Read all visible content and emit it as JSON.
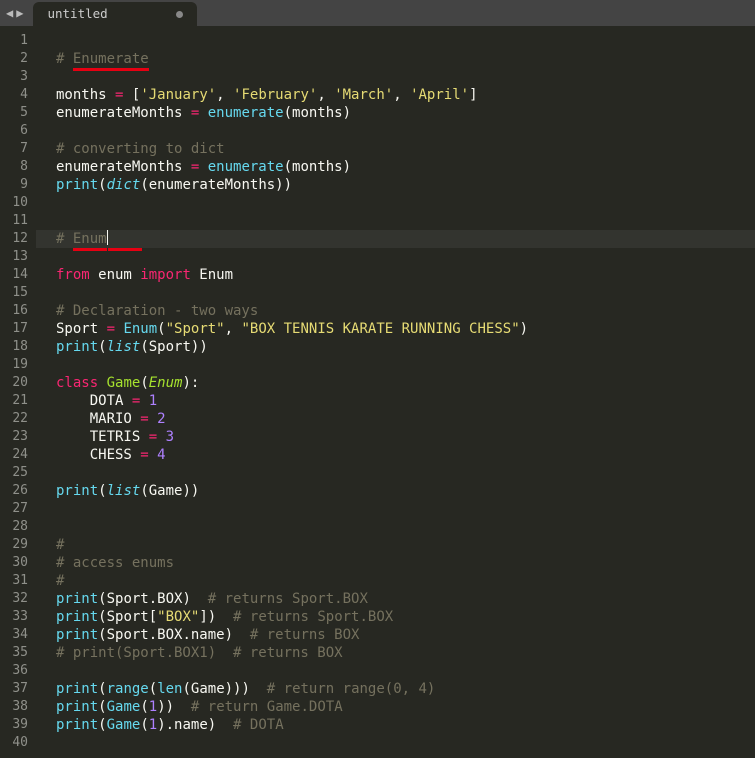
{
  "tab": {
    "title": "untitled",
    "dirty": true
  },
  "cursor_line": 12,
  "lines": [
    {
      "n": 1,
      "t": []
    },
    {
      "n": 2,
      "t": [
        {
          "c": "c",
          "v": "# "
        },
        {
          "c": "c",
          "v": "Enumerate",
          "u": true
        }
      ]
    },
    {
      "n": 3,
      "t": []
    },
    {
      "n": 4,
      "t": [
        {
          "c": "p",
          "v": "months "
        },
        {
          "c": "op",
          "v": "="
        },
        {
          "c": "p",
          "v": " ["
        },
        {
          "c": "s",
          "v": "'January'"
        },
        {
          "c": "p",
          "v": ", "
        },
        {
          "c": "s",
          "v": "'February'"
        },
        {
          "c": "p",
          "v": ", "
        },
        {
          "c": "s",
          "v": "'March'"
        },
        {
          "c": "p",
          "v": ", "
        },
        {
          "c": "s",
          "v": "'April'"
        },
        {
          "c": "p",
          "v": "]"
        }
      ]
    },
    {
      "n": 5,
      "t": [
        {
          "c": "p",
          "v": "enumerateMonths "
        },
        {
          "c": "op",
          "v": "="
        },
        {
          "c": "p",
          "v": " "
        },
        {
          "c": "fn",
          "v": "enumerate"
        },
        {
          "c": "p",
          "v": "(months)"
        }
      ]
    },
    {
      "n": 6,
      "t": []
    },
    {
      "n": 7,
      "t": [
        {
          "c": "c",
          "v": "# converting to dict"
        }
      ]
    },
    {
      "n": 8,
      "t": [
        {
          "c": "p",
          "v": "enumerateMonths "
        },
        {
          "c": "op",
          "v": "="
        },
        {
          "c": "p",
          "v": " "
        },
        {
          "c": "fn",
          "v": "enumerate"
        },
        {
          "c": "p",
          "v": "(months)"
        }
      ]
    },
    {
      "n": 9,
      "t": [
        {
          "c": "fn",
          "v": "print"
        },
        {
          "c": "p",
          "v": "("
        },
        {
          "c": "fi",
          "v": "dict"
        },
        {
          "c": "p",
          "v": "(enumerateMonths))"
        }
      ]
    },
    {
      "n": 10,
      "t": []
    },
    {
      "n": 11,
      "t": []
    },
    {
      "n": 12,
      "t": [
        {
          "c": "c",
          "v": "# "
        },
        {
          "c": "c",
          "v": "Enum",
          "u": true,
          "cursor": true
        },
        {
          "c": "c",
          "v": "    ",
          "u": true
        }
      ]
    },
    {
      "n": 13,
      "t": []
    },
    {
      "n": 14,
      "t": [
        {
          "c": "kw",
          "v": "from"
        },
        {
          "c": "p",
          "v": " enum "
        },
        {
          "c": "kw",
          "v": "import"
        },
        {
          "c": "p",
          "v": " Enum"
        }
      ]
    },
    {
      "n": 15,
      "t": []
    },
    {
      "n": 16,
      "t": [
        {
          "c": "c",
          "v": "# Declaration - two ways"
        }
      ]
    },
    {
      "n": 17,
      "t": [
        {
          "c": "p",
          "v": "Sport "
        },
        {
          "c": "op",
          "v": "="
        },
        {
          "c": "p",
          "v": " "
        },
        {
          "c": "fn",
          "v": "Enum"
        },
        {
          "c": "p",
          "v": "("
        },
        {
          "c": "s",
          "v": "\"Sport\""
        },
        {
          "c": "p",
          "v": ", "
        },
        {
          "c": "s",
          "v": "\"BOX TENNIS KARATE RUNNING CHESS\""
        },
        {
          "c": "p",
          "v": ")"
        }
      ]
    },
    {
      "n": 18,
      "t": [
        {
          "c": "fn",
          "v": "print"
        },
        {
          "c": "p",
          "v": "("
        },
        {
          "c": "fi",
          "v": "list"
        },
        {
          "c": "p",
          "v": "(Sport))"
        }
      ]
    },
    {
      "n": 19,
      "t": []
    },
    {
      "n": 20,
      "t": [
        {
          "c": "kw",
          "v": "class"
        },
        {
          "c": "p",
          "v": " "
        },
        {
          "c": "nm",
          "v": "Game"
        },
        {
          "c": "p",
          "v": "("
        },
        {
          "c": "cl",
          "v": "Enum"
        },
        {
          "c": "p",
          "v": "):"
        }
      ]
    },
    {
      "n": 21,
      "t": [
        {
          "c": "p",
          "v": "    DOTA "
        },
        {
          "c": "op",
          "v": "="
        },
        {
          "c": "p",
          "v": " "
        },
        {
          "c": "n",
          "v": "1"
        }
      ]
    },
    {
      "n": 22,
      "t": [
        {
          "c": "p",
          "v": "    MARIO "
        },
        {
          "c": "op",
          "v": "="
        },
        {
          "c": "p",
          "v": " "
        },
        {
          "c": "n",
          "v": "2"
        }
      ]
    },
    {
      "n": 23,
      "t": [
        {
          "c": "p",
          "v": "    TETRIS "
        },
        {
          "c": "op",
          "v": "="
        },
        {
          "c": "p",
          "v": " "
        },
        {
          "c": "n",
          "v": "3"
        }
      ]
    },
    {
      "n": 24,
      "t": [
        {
          "c": "p",
          "v": "    CHESS "
        },
        {
          "c": "op",
          "v": "="
        },
        {
          "c": "p",
          "v": " "
        },
        {
          "c": "n",
          "v": "4"
        }
      ]
    },
    {
      "n": 25,
      "t": []
    },
    {
      "n": 26,
      "t": [
        {
          "c": "fn",
          "v": "print"
        },
        {
          "c": "p",
          "v": "("
        },
        {
          "c": "fi",
          "v": "list"
        },
        {
          "c": "p",
          "v": "(Game))"
        }
      ]
    },
    {
      "n": 27,
      "t": []
    },
    {
      "n": 28,
      "t": []
    },
    {
      "n": 29,
      "t": [
        {
          "c": "c",
          "v": "#"
        }
      ]
    },
    {
      "n": 30,
      "t": [
        {
          "c": "c",
          "v": "# access enums"
        }
      ]
    },
    {
      "n": 31,
      "t": [
        {
          "c": "c",
          "v": "#"
        }
      ]
    },
    {
      "n": 32,
      "t": [
        {
          "c": "fn",
          "v": "print"
        },
        {
          "c": "p",
          "v": "(Sport.BOX)  "
        },
        {
          "c": "c",
          "v": "# returns Sport.BOX"
        }
      ]
    },
    {
      "n": 33,
      "t": [
        {
          "c": "fn",
          "v": "print"
        },
        {
          "c": "p",
          "v": "(Sport["
        },
        {
          "c": "s",
          "v": "\"BOX\""
        },
        {
          "c": "p",
          "v": "])  "
        },
        {
          "c": "c",
          "v": "# returns Sport.BOX"
        }
      ]
    },
    {
      "n": 34,
      "t": [
        {
          "c": "fn",
          "v": "print"
        },
        {
          "c": "p",
          "v": "(Sport.BOX.name)  "
        },
        {
          "c": "c",
          "v": "# returns BOX"
        }
      ]
    },
    {
      "n": 35,
      "t": [
        {
          "c": "c",
          "v": "# print(Sport.BOX1)  # returns BOX"
        }
      ]
    },
    {
      "n": 36,
      "t": []
    },
    {
      "n": 37,
      "t": [
        {
          "c": "fn",
          "v": "print"
        },
        {
          "c": "p",
          "v": "("
        },
        {
          "c": "fn",
          "v": "range"
        },
        {
          "c": "p",
          "v": "("
        },
        {
          "c": "fn",
          "v": "len"
        },
        {
          "c": "p",
          "v": "(Game)))  "
        },
        {
          "c": "c",
          "v": "# return range(0, 4)"
        }
      ]
    },
    {
      "n": 38,
      "t": [
        {
          "c": "fn",
          "v": "print"
        },
        {
          "c": "p",
          "v": "("
        },
        {
          "c": "fn",
          "v": "Game"
        },
        {
          "c": "p",
          "v": "("
        },
        {
          "c": "n",
          "v": "1"
        },
        {
          "c": "p",
          "v": "))  "
        },
        {
          "c": "c",
          "v": "# return Game.DOTA"
        }
      ]
    },
    {
      "n": 39,
      "t": [
        {
          "c": "fn",
          "v": "print"
        },
        {
          "c": "p",
          "v": "("
        },
        {
          "c": "fn",
          "v": "Game"
        },
        {
          "c": "p",
          "v": "("
        },
        {
          "c": "n",
          "v": "1"
        },
        {
          "c": "p",
          "v": ").name)  "
        },
        {
          "c": "c",
          "v": "# DOTA"
        }
      ]
    },
    {
      "n": 40,
      "t": []
    }
  ]
}
